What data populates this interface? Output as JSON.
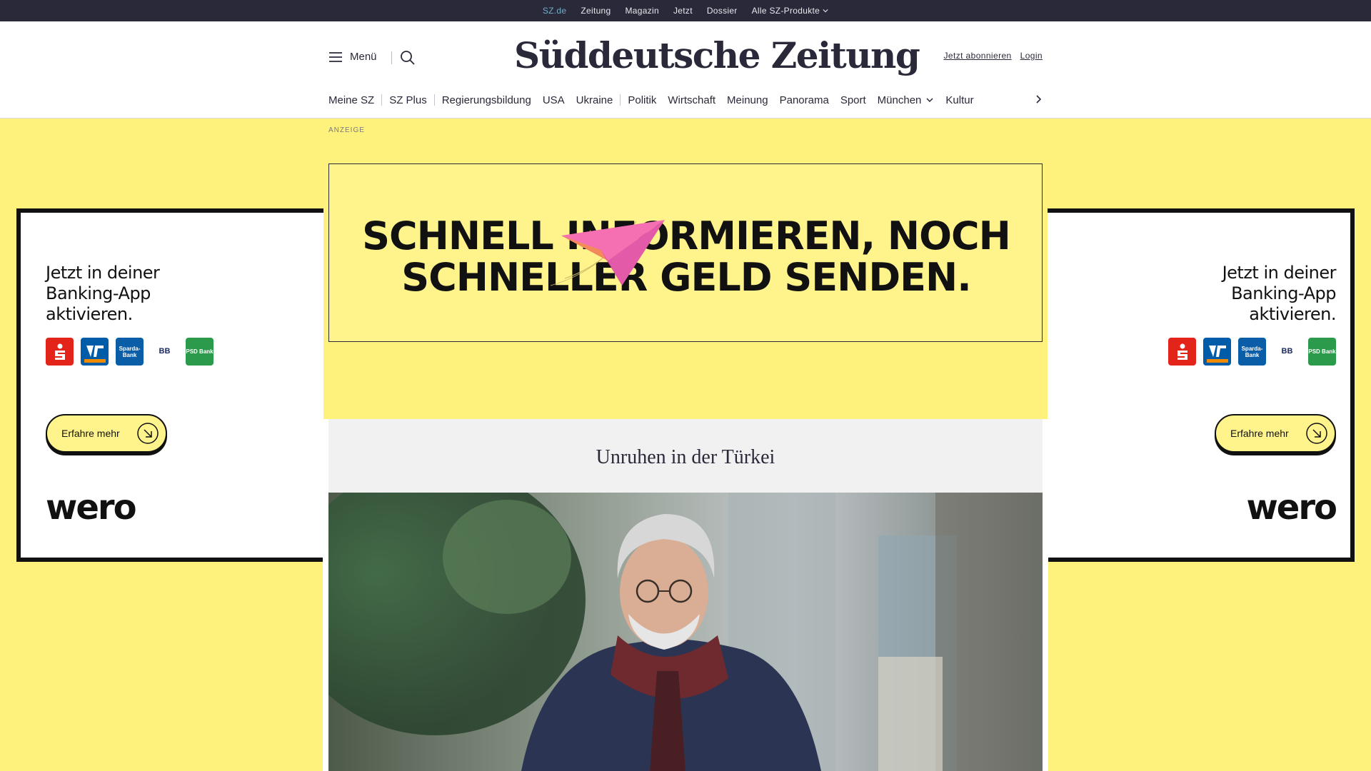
{
  "topbar": {
    "items": [
      "SZ.de",
      "Zeitung",
      "Magazin",
      "Jetzt",
      "Dossier",
      "Alle SZ-Produkte"
    ]
  },
  "header": {
    "menu_label": "Menü",
    "logo": "Süddeutsche Zeitung",
    "subscribe": "Jetzt abonnieren",
    "login": "Login"
  },
  "nav": {
    "items": [
      "Meine SZ",
      "SZ Plus",
      "Regierungsbildung",
      "USA",
      "Ukraine",
      "Politik",
      "Wirtschaft",
      "Meinung",
      "Panorama",
      "Sport",
      "München",
      "Kultur"
    ]
  },
  "ad": {
    "tag": "ANZEIGE",
    "banner_line1": "SCHNELL INFORMIEREN, NOCH",
    "banner_line2": "SCHNELLER GELD SENDEN.",
    "side_line1": "Jetzt in deiner",
    "side_line2": "Banking-App",
    "side_line3": "aktivieren.",
    "cta": "Erfahre mehr",
    "brand": "wero",
    "banks": [
      "Sparda-Bank",
      "BB",
      "PSD Bank"
    ],
    "colors": {
      "background": "#fff27c",
      "banner": "#fff48c",
      "sparkasse": "#e3241b",
      "volksbank": "#005ca9",
      "sparda": "#0a5ea8",
      "psd": "#2c9a4b"
    }
  },
  "article": {
    "topic": "Unruhen in der Türkei"
  }
}
